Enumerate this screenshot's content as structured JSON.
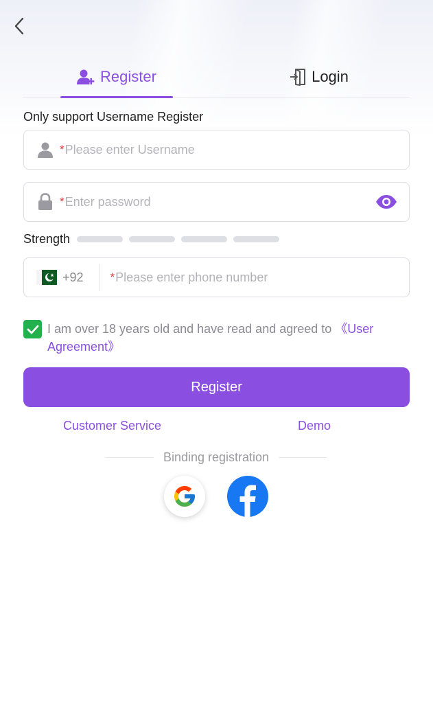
{
  "header": {
    "back_icon": "chevron-left-icon"
  },
  "tabs": [
    {
      "label": "Register",
      "icon": "user-add-icon",
      "active": true
    },
    {
      "label": "Login",
      "icon": "login-door-icon",
      "active": false
    }
  ],
  "form": {
    "note": "Only support Username Register",
    "required_mark": "*",
    "username": {
      "placeholder": "Please enter Username",
      "value": "",
      "icon": "user-icon"
    },
    "password": {
      "placeholder": "Enter password",
      "value": "",
      "icon": "lock-icon",
      "toggle_icon": "eye-icon"
    },
    "strength": {
      "label": "Strength",
      "bars": 4,
      "level": 0
    },
    "phone": {
      "country_code": "+92",
      "flag_icon": "pakistan-flag-icon",
      "placeholder": "Please enter phone number",
      "value": ""
    },
    "agreement": {
      "checked": true,
      "text": "I am over 18 years old and have read and agreed to ",
      "link": "《User Agreement》"
    },
    "submit_label": "Register"
  },
  "links": {
    "customer_service": "Customer Service",
    "demo": "Demo"
  },
  "binding": {
    "label": "Binding registration",
    "providers": [
      {
        "name": "google-icon"
      },
      {
        "name": "facebook-icon"
      }
    ]
  },
  "colors": {
    "accent": "#8a4fe0",
    "check": "#22b14c",
    "required": "#e23b3b",
    "facebook": "#1877f2"
  }
}
